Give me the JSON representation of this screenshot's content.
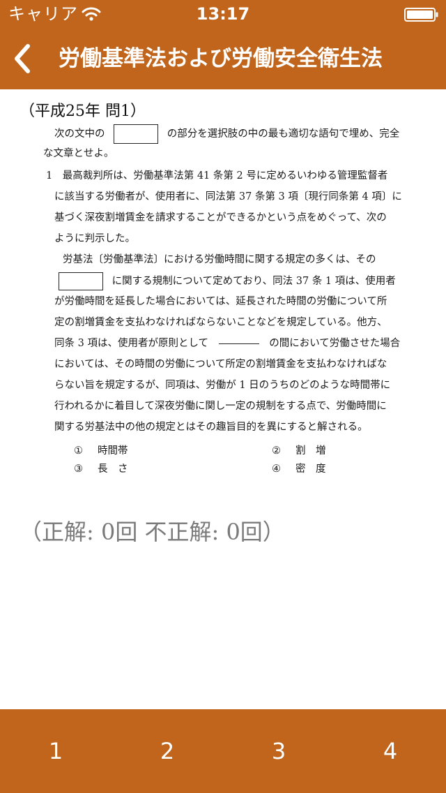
{
  "status_bar": {
    "carrier": "キャリア",
    "time": "13:17"
  },
  "nav": {
    "title": "労働基準法および労働安全衛生法"
  },
  "question": {
    "heading": "（平成25年 問1）",
    "intro_1a": "次の文中の",
    "intro_1b": "の部分を選択肢の中の最も適切な語句で埋め、完全",
    "intro_2": "な文章とせよ。",
    "item_1": "1　最高裁判所は、労働基準法第 41 条第 2 号に定めるいわゆる管理監督者",
    "item_2": "に該当する労働者が、使用者に、同法第 37 条第 3 項〔現行同条第 4 項〕に",
    "item_3": "基づく深夜割増賃金を請求することができるかという点をめぐって、次の",
    "item_4": "ように判示した。",
    "quote_1": "労基法〔労働基準法〕における労働時間に関する規定の多くは、その",
    "quote_2b": "に関する規制について定めており、同法 37 条 1 項は、使用者",
    "quote_3": "が労働時間を延長した場合においては、延長された時間の労働について所",
    "quote_4": "定の割増賃金を支払わなければならないことなどを規定している。他方、",
    "quote_5a": "同条 3 項は、使用者が原則として",
    "quote_5b": "の間において労働させた場合",
    "quote_6": "においては、その時間の労働について所定の割増賃金を支払わなければな",
    "quote_7": "らない旨を規定するが、同項は、労働が 1 日のうちのどのような時間帯に",
    "quote_8": "行われるかに着目して深夜労働に関し一定の規制をする点で、労働時間に",
    "quote_9": "関する労基法中の他の規定とはその趣旨目的を異にすると解される。",
    "choices": [
      {
        "num": "①",
        "label": "時間帯"
      },
      {
        "num": "②",
        "label": "割　増"
      },
      {
        "num": "③",
        "label": "長　さ"
      },
      {
        "num": "④",
        "label": "密　度"
      }
    ]
  },
  "score": {
    "text": "（正解: 0回 不正解: 0回）"
  },
  "answers": [
    "1",
    "2",
    "3",
    "4"
  ],
  "colors": {
    "accent": "#c0651b",
    "score_text": "#7a7a7a"
  },
  "icons": {
    "wifi": "wifi-icon",
    "battery": "battery-icon",
    "back": "chevron-left-icon"
  }
}
